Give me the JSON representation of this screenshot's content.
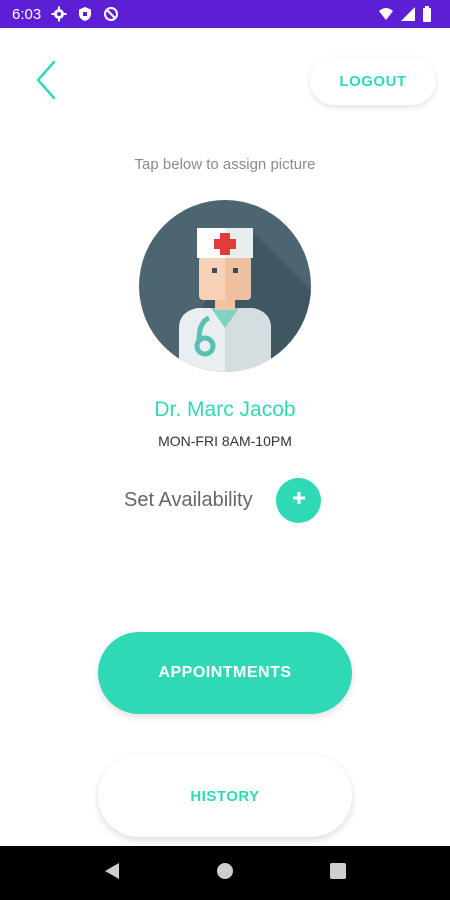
{
  "status_bar": {
    "time": "6:03",
    "background": "#5c1fd6",
    "left_icons": [
      "gear-icon",
      "shield-icon",
      "data-saver-icon"
    ],
    "right_icons": [
      "wifi-icon",
      "signal-icon",
      "battery-icon"
    ]
  },
  "header": {
    "back_icon": "chevron-left-icon",
    "logout_label": "LOGOUT"
  },
  "profile": {
    "hint": "Tap below to assign picture",
    "avatar_icon": "doctor-avatar-icon",
    "name": "Dr. Marc Jacob",
    "hours": "MON-FRI 8AM-10PM"
  },
  "availability": {
    "label": "Set Availability",
    "add_icon": "plus-icon"
  },
  "actions": {
    "appointments_label": "APPOINTMENTS",
    "history_label": "HISTORY"
  },
  "nav_bar": {
    "icons": [
      "back-triangle-icon",
      "home-circle-icon",
      "recents-square-icon"
    ]
  },
  "colors": {
    "accent": "#2fd9b5",
    "avatar_bg": "#4d6570",
    "text_muted": "#8a8a8a"
  }
}
